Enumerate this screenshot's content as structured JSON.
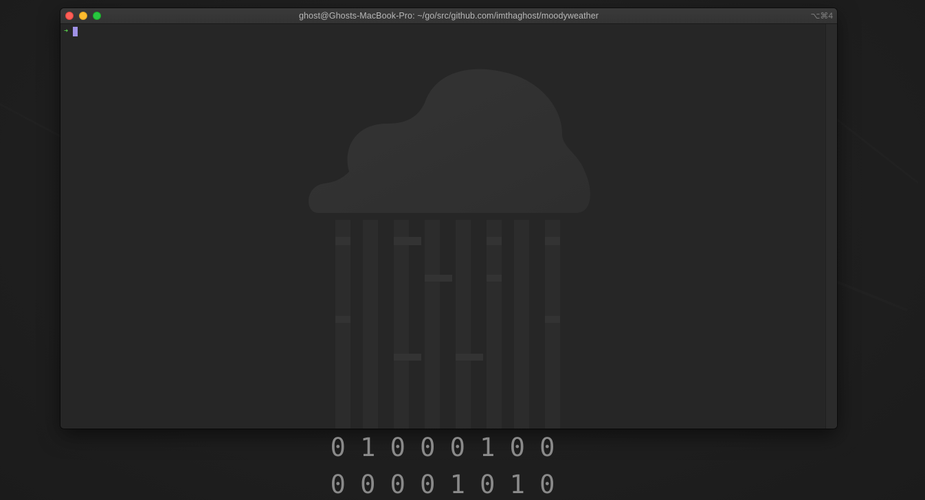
{
  "window": {
    "title": "ghost@Ghosts-MacBook-Pro: ~/go/src/github.com/imthaghost/moodyweather",
    "shortcut": "⌥⌘4",
    "close_icon": "close-icon",
    "minimize_icon": "minimize-icon",
    "maximize_icon": "maximize-icon"
  },
  "terminal": {
    "prompt_symbol": "➜",
    "prompt_color": "#5ad24d",
    "cursor_color": "#9f91e6"
  },
  "binary": {
    "row1": [
      "0",
      "1",
      "0",
      "0",
      "0",
      "1",
      "0",
      "0"
    ],
    "row2": [
      "0",
      "0",
      "0",
      "0",
      "1",
      "0",
      "1",
      "0"
    ]
  },
  "colors": {
    "close": "#fe5f57",
    "minimize": "#febc2e",
    "maximize": "#28c840"
  }
}
